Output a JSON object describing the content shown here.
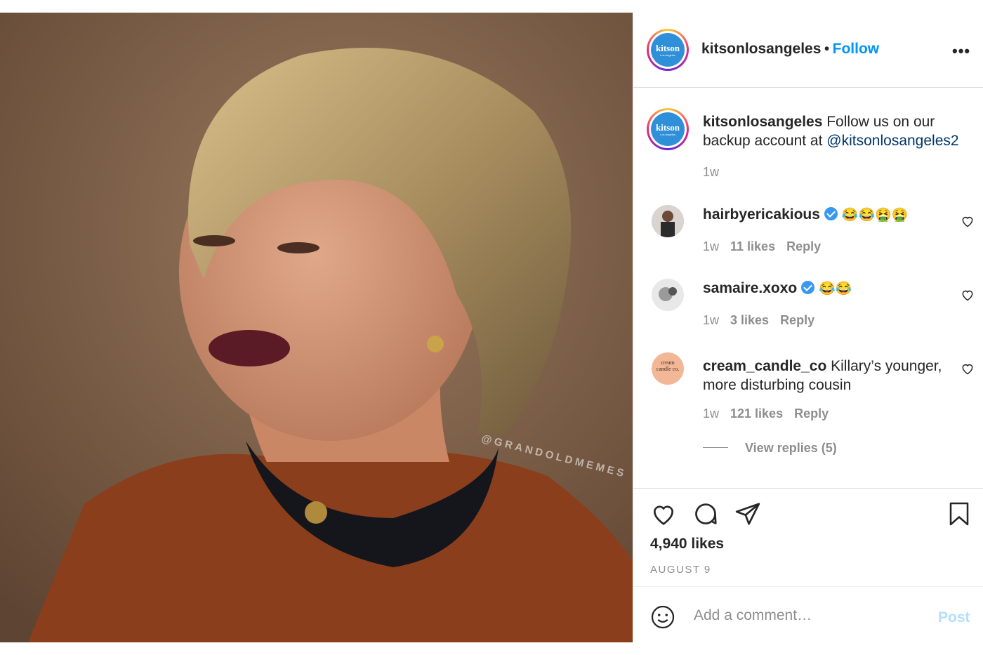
{
  "post": {
    "author": "kitsonlosangeles",
    "separator": "•",
    "follow_label": "Follow",
    "more_label": "•••",
    "avatar_text": "kitson",
    "avatar_subtext": "Los Angeles",
    "watermark": "@GRANDOLDMEMES"
  },
  "caption": {
    "username": "kitsonlosangeles",
    "text": " Follow us on our backup account at ",
    "mention": "@kitsonlosangeles2",
    "time": "1w"
  },
  "comments": [
    {
      "username": "hairbyericakious",
      "verified": true,
      "text": "😂😂🤮🤮",
      "time": "1w",
      "likes": "11 likes",
      "reply": "Reply"
    },
    {
      "username": "samaire.xoxo",
      "verified": true,
      "text": "😂😂",
      "time": "1w",
      "likes": "3 likes",
      "reply": "Reply"
    },
    {
      "username": "cream_candle_co",
      "verified": false,
      "text": " Killary’s younger, more disturbing cousin",
      "time": "1w",
      "likes": "121 likes",
      "reply": "Reply",
      "avatar_text": "cream candle co."
    }
  ],
  "view_replies": "View replies (5)",
  "stats": {
    "likes": "4,940 likes",
    "date": "AUGUST 9"
  },
  "add_comment": {
    "placeholder": "Add a comment…",
    "post_label": "Post"
  },
  "colors": {
    "link": "#0095f6",
    "muted": "#8e8e8e",
    "mention": "#00376b",
    "verified": "#3897f0"
  },
  "icons": [
    "heart-icon",
    "comment-icon",
    "share-icon",
    "bookmark-icon",
    "emoji-icon",
    "more-icon",
    "verified-icon"
  ]
}
